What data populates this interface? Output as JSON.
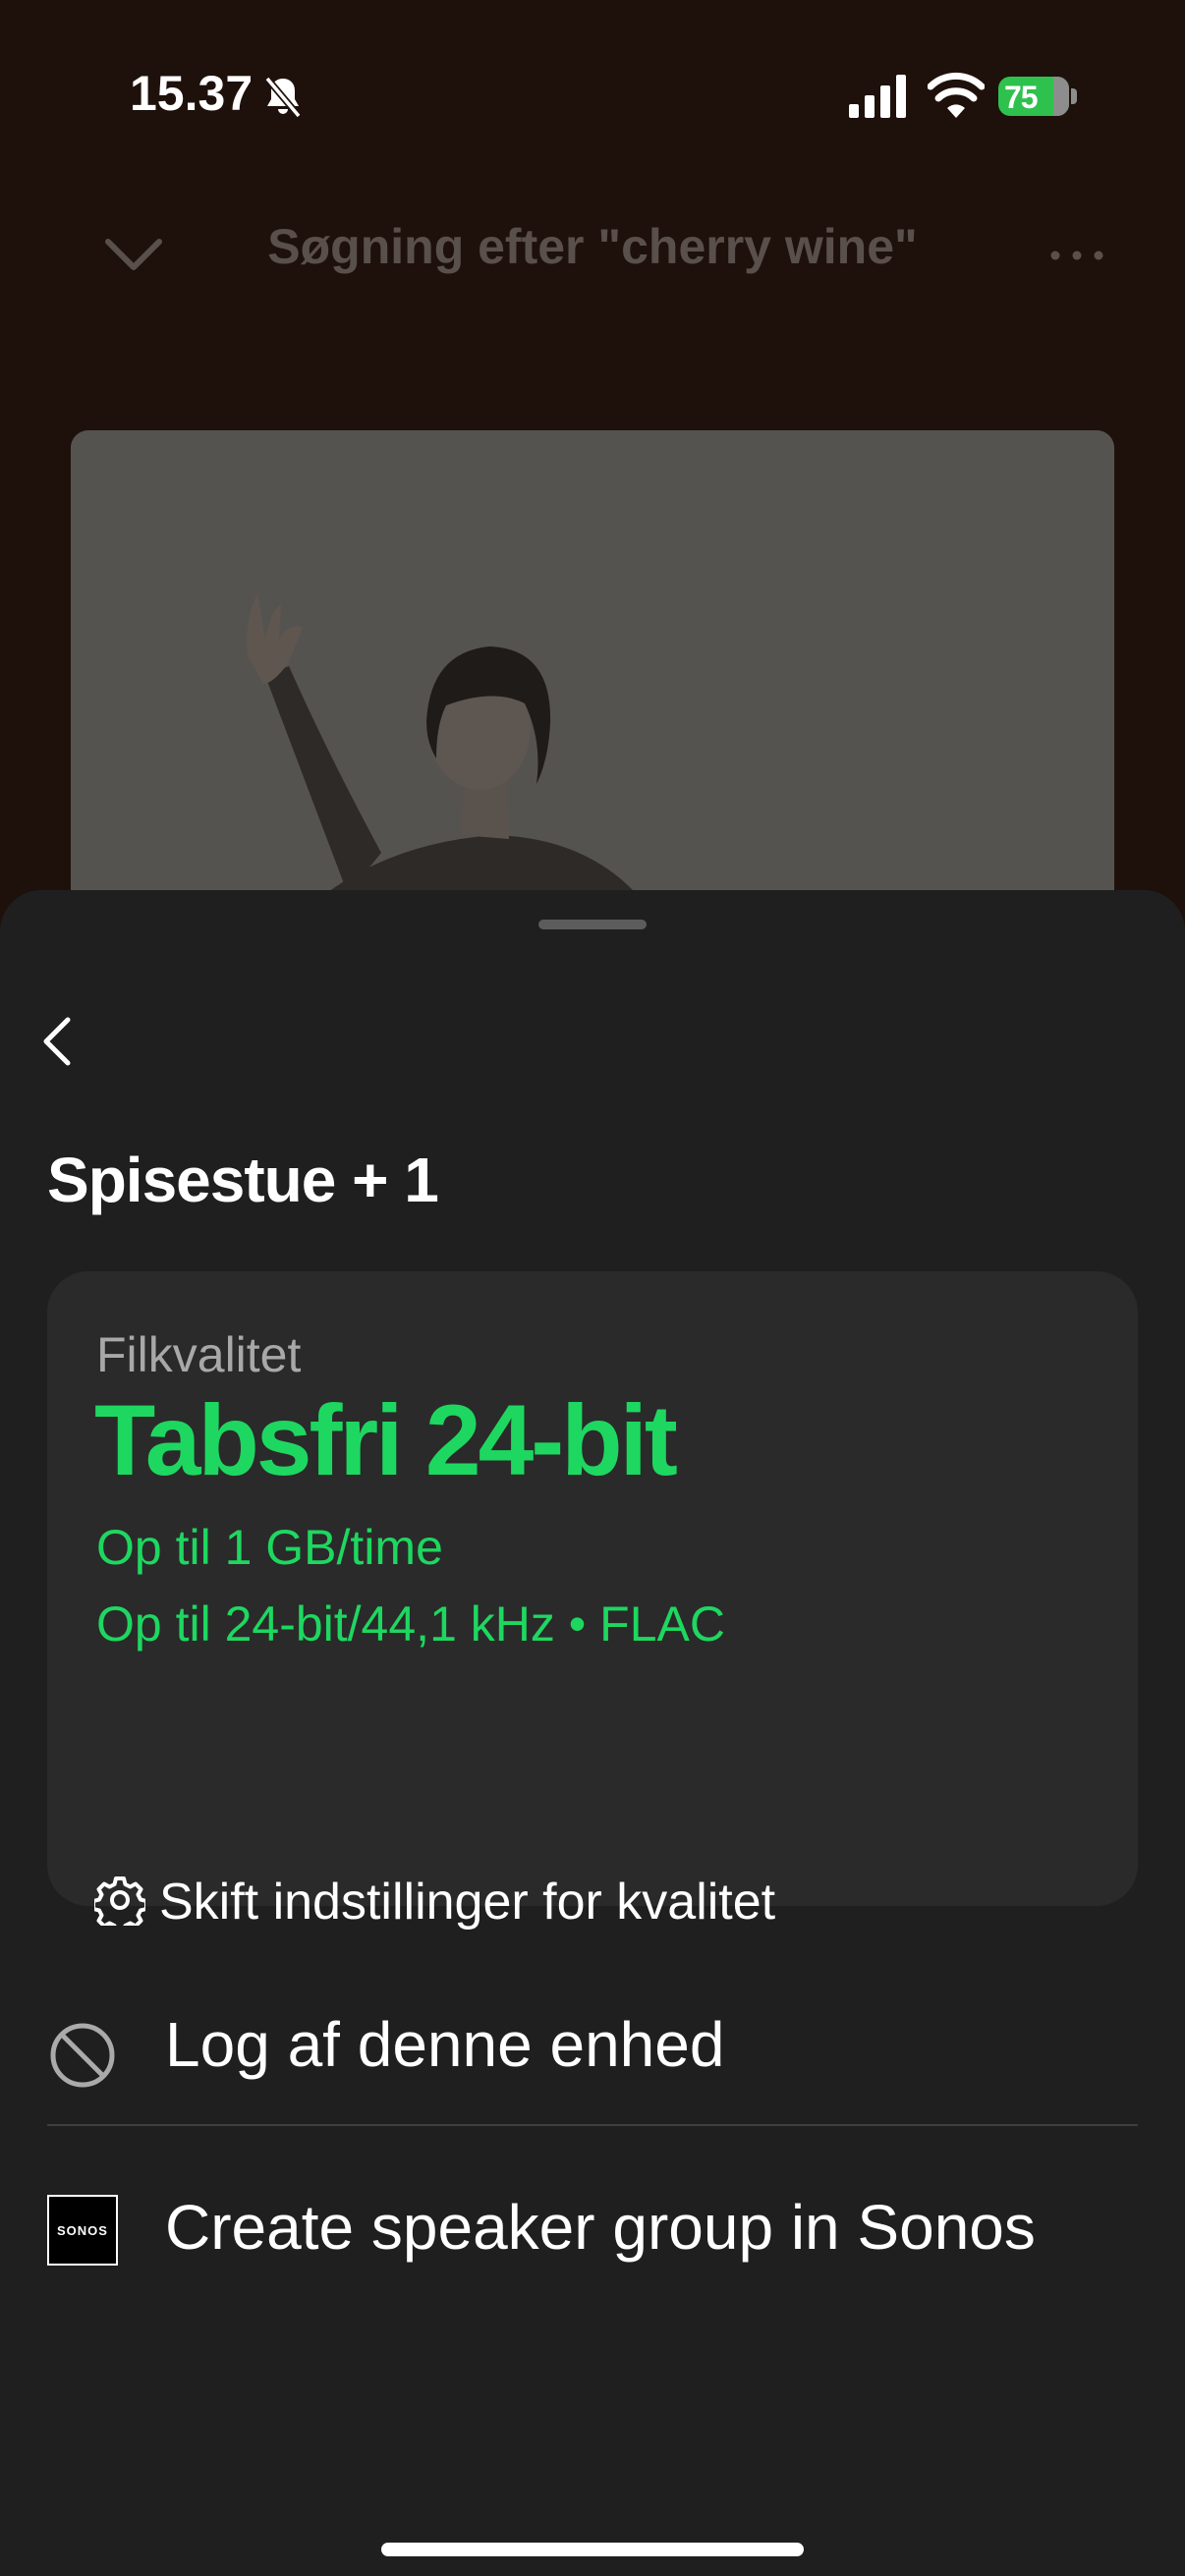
{
  "status_bar": {
    "time": "15.37",
    "battery_level": "75",
    "icons": [
      "bell-slash-icon",
      "cellular-signal-icon",
      "wifi-icon",
      "battery-charging-icon"
    ]
  },
  "player": {
    "title": "Søgning efter \"cherry wine\"",
    "icons": [
      "chevron-down-icon",
      "more-icon"
    ]
  },
  "sheet": {
    "device_name": "Spisestue + 1",
    "quality_card": {
      "label": "Filkvalitet",
      "quality": "Tabsfri 24-bit",
      "line1": "Op til 1 GB/time",
      "line2": "Op til 24-bit/44,1 kHz • FLAC",
      "settings_label": "Skift indstillinger for kvalitet"
    },
    "menu": {
      "logout_label": "Log af denne enhed",
      "sonos_label": "Create speaker group in Sonos",
      "sonos_logo_text": "SONOS"
    }
  },
  "colors": {
    "accent": "#1ed760",
    "sheet_bg": "#1f1f1f",
    "card_bg": "#2a2a2a",
    "background": "#1e110b"
  }
}
